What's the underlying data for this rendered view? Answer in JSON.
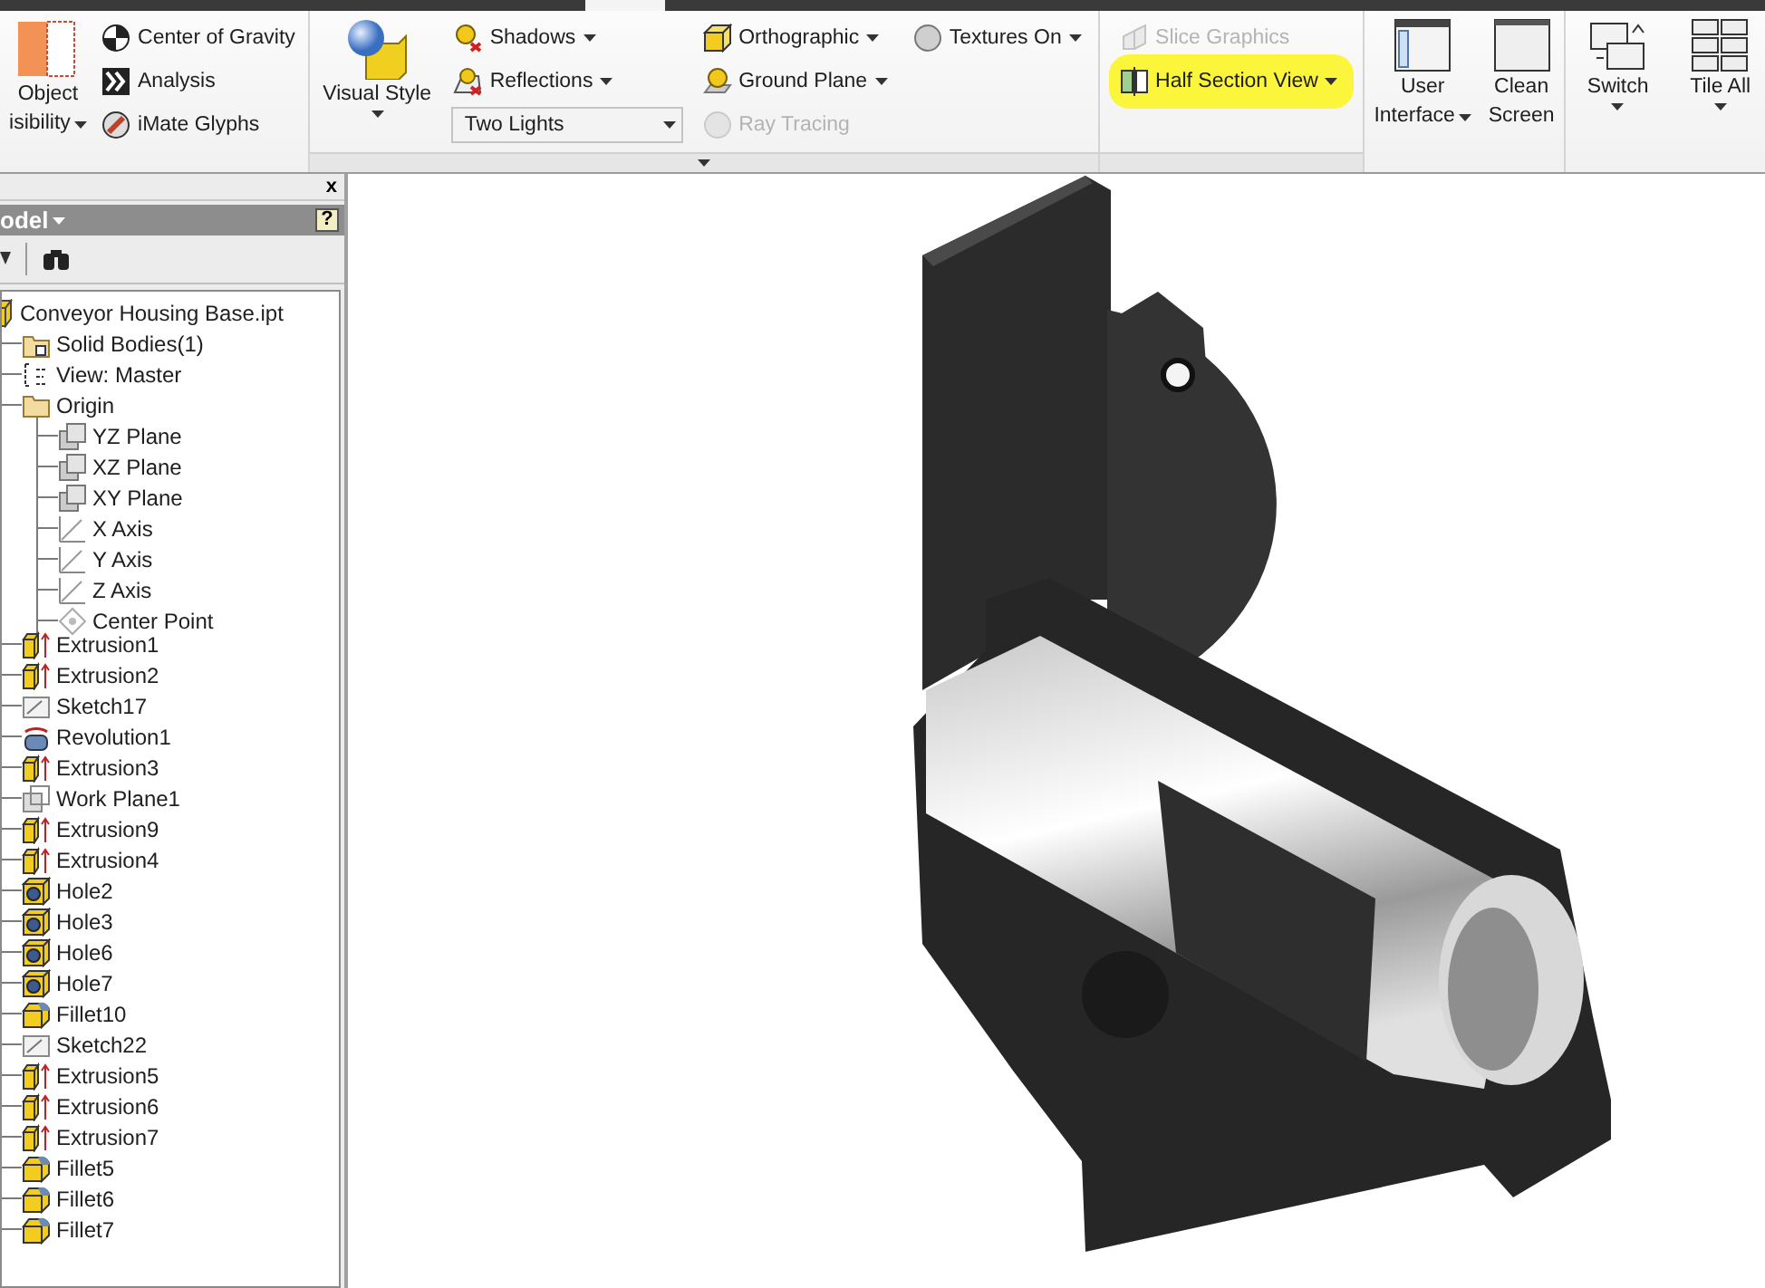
{
  "ribbon": {
    "panels": [
      {
        "columns": [
          {
            "kind": "large",
            "lines": [
              "Object",
              "isibility"
            ],
            "dropdown": true
          },
          {
            "kind": "stack",
            "items": [
              {
                "kind": "button",
                "label": "Center of Gravity",
                "dropdown": false,
                "disabled": false,
                "highlighted": false
              },
              {
                "kind": "button",
                "label": "Analysis",
                "dropdown": false,
                "disabled": false,
                "highlighted": false
              },
              {
                "kind": "button",
                "label": "iMate Glyphs",
                "dropdown": false,
                "disabled": false,
                "highlighted": false
              }
            ]
          }
        ]
      },
      {
        "columns": [
          {
            "kind": "large",
            "lines": [
              "Visual Style"
            ],
            "dropdown": true
          },
          {
            "kind": "stack",
            "items": [
              {
                "kind": "button",
                "label": "Shadows",
                "dropdown": true,
                "disabled": false,
                "highlighted": false
              },
              {
                "kind": "button",
                "label": "Reflections",
                "dropdown": true,
                "disabled": false,
                "highlighted": false
              },
              {
                "kind": "combo",
                "label": "Two Lights",
                "dropdown": true,
                "disabled": false,
                "highlighted": false
              }
            ]
          },
          {
            "kind": "stack",
            "items": [
              {
                "kind": "button",
                "label": "Orthographic",
                "dropdown": true,
                "disabled": false,
                "highlighted": false
              },
              {
                "kind": "button",
                "label": "Ground Plane",
                "dropdown": true,
                "disabled": false,
                "highlighted": false
              },
              {
                "kind": "button",
                "label": "Ray Tracing",
                "dropdown": false,
                "disabled": true,
                "highlighted": false
              }
            ]
          },
          {
            "kind": "stack",
            "items": [
              {
                "kind": "button",
                "label": "Textures On",
                "dropdown": true,
                "disabled": false,
                "highlighted": false
              }
            ]
          }
        ]
      },
      {
        "columns": [
          {
            "kind": "stack",
            "items": [
              {
                "kind": "button",
                "label": "Slice Graphics",
                "dropdown": false,
                "disabled": true,
                "highlighted": false
              },
              {
                "kind": "button",
                "label": "Half Section View",
                "dropdown": true,
                "disabled": false,
                "highlighted": true
              }
            ]
          }
        ]
      },
      {
        "columns": [
          {
            "kind": "large",
            "lines": [
              "User",
              "Interface"
            ],
            "dropdown": true
          },
          {
            "kind": "large",
            "lines": [
              "Clean",
              "Screen"
            ],
            "dropdown": false
          }
        ]
      },
      {
        "columns": [
          {
            "kind": "large",
            "lines": [
              "Switch"
            ],
            "dropdown": true
          },
          {
            "kind": "large",
            "lines": [
              "Tile All"
            ],
            "dropdown": true
          }
        ]
      }
    ]
  },
  "browser": {
    "close_glyph": "x",
    "title": "odel",
    "help_glyph": "?",
    "tree": [
      {
        "label": "Conveyor Housing Base.ipt",
        "kind": "part",
        "expanded": true,
        "children": [
          {
            "label": "Solid Bodies(1)",
            "kind": "bodies"
          },
          {
            "label": "View: Master",
            "kind": "view"
          },
          {
            "label": "Origin",
            "kind": "folder",
            "expanded": true,
            "children": [
              {
                "label": "YZ Plane",
                "kind": "plane"
              },
              {
                "label": "XZ Plane",
                "kind": "plane"
              },
              {
                "label": "XY Plane",
                "kind": "plane"
              },
              {
                "label": "X Axis",
                "kind": "axis"
              },
              {
                "label": "Y Axis",
                "kind": "axis"
              },
              {
                "label": "Z Axis",
                "kind": "axis"
              },
              {
                "label": "Center Point",
                "kind": "point"
              }
            ]
          },
          {
            "label": "Extrusion1",
            "kind": "extrusion"
          },
          {
            "label": "Extrusion2",
            "kind": "extrusion"
          },
          {
            "label": "Sketch17",
            "kind": "sketch"
          },
          {
            "label": "Revolution1",
            "kind": "revolution"
          },
          {
            "label": "Extrusion3",
            "kind": "extrusion"
          },
          {
            "label": "Work Plane1",
            "kind": "workplane"
          },
          {
            "label": "Extrusion9",
            "kind": "extrusion"
          },
          {
            "label": "Extrusion4",
            "kind": "extrusion"
          },
          {
            "label": "Hole2",
            "kind": "hole"
          },
          {
            "label": "Hole3",
            "kind": "hole"
          },
          {
            "label": "Hole6",
            "kind": "hole"
          },
          {
            "label": "Hole7",
            "kind": "hole"
          },
          {
            "label": "Fillet10",
            "kind": "fillet"
          },
          {
            "label": "Sketch22",
            "kind": "sketch"
          },
          {
            "label": "Extrusion5",
            "kind": "extrusion"
          },
          {
            "label": "Extrusion6",
            "kind": "extrusion"
          },
          {
            "label": "Extrusion7",
            "kind": "extrusion"
          },
          {
            "label": "Fillet5",
            "kind": "fillet"
          },
          {
            "label": "Fillet6",
            "kind": "fillet"
          },
          {
            "label": "Fillet7",
            "kind": "fillet"
          }
        ]
      }
    ]
  }
}
